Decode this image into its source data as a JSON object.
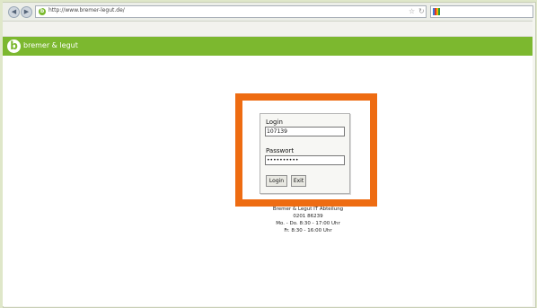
{
  "browser": {
    "url": "http://www.bremer-legut.de/",
    "favicon": "b",
    "back_icon": "arrow-left",
    "forward_icon": "arrow-right",
    "star_icon": "star",
    "reload_icon": "reload",
    "search_engine_icon": "google"
  },
  "header": {
    "logo_letter": "b",
    "logo_text": "bremer & legut",
    "color": "#7cb82f"
  },
  "login": {
    "login_label": "Login",
    "login_value": "107139",
    "password_label": "Passwort",
    "password_value": "••••••••••",
    "login_button": "Login",
    "exit_button": "Exit",
    "highlight_color": "#ee6c12"
  },
  "info": {
    "line1": "Bremer & Legut IT Abteilung",
    "line2": "0201 86239",
    "line3": "Mo. - Do. 8:30 - 17:00 Uhr",
    "line4": "Fr. 8:30 - 16:00 Uhr"
  }
}
